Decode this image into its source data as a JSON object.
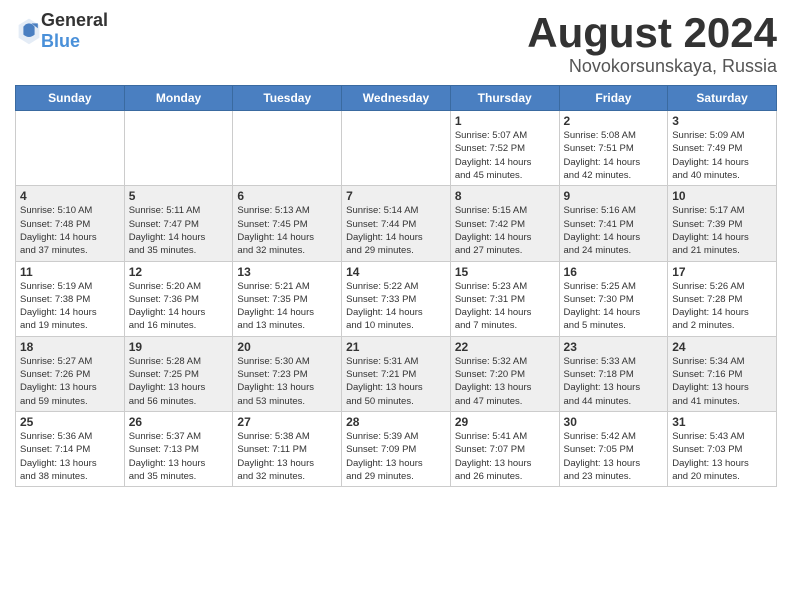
{
  "header": {
    "logo": {
      "general": "General",
      "blue": "Blue"
    },
    "title": "August 2024",
    "location": "Novokorsunskaya, Russia"
  },
  "weekdays": [
    "Sunday",
    "Monday",
    "Tuesday",
    "Wednesday",
    "Thursday",
    "Friday",
    "Saturday"
  ],
  "weeks": [
    [
      {
        "day": "",
        "info": ""
      },
      {
        "day": "",
        "info": ""
      },
      {
        "day": "",
        "info": ""
      },
      {
        "day": "",
        "info": ""
      },
      {
        "day": "1",
        "info": "Sunrise: 5:07 AM\nSunset: 7:52 PM\nDaylight: 14 hours\nand 45 minutes."
      },
      {
        "day": "2",
        "info": "Sunrise: 5:08 AM\nSunset: 7:51 PM\nDaylight: 14 hours\nand 42 minutes."
      },
      {
        "day": "3",
        "info": "Sunrise: 5:09 AM\nSunset: 7:49 PM\nDaylight: 14 hours\nand 40 minutes."
      }
    ],
    [
      {
        "day": "4",
        "info": "Sunrise: 5:10 AM\nSunset: 7:48 PM\nDaylight: 14 hours\nand 37 minutes."
      },
      {
        "day": "5",
        "info": "Sunrise: 5:11 AM\nSunset: 7:47 PM\nDaylight: 14 hours\nand 35 minutes."
      },
      {
        "day": "6",
        "info": "Sunrise: 5:13 AM\nSunset: 7:45 PM\nDaylight: 14 hours\nand 32 minutes."
      },
      {
        "day": "7",
        "info": "Sunrise: 5:14 AM\nSunset: 7:44 PM\nDaylight: 14 hours\nand 29 minutes."
      },
      {
        "day": "8",
        "info": "Sunrise: 5:15 AM\nSunset: 7:42 PM\nDaylight: 14 hours\nand 27 minutes."
      },
      {
        "day": "9",
        "info": "Sunrise: 5:16 AM\nSunset: 7:41 PM\nDaylight: 14 hours\nand 24 minutes."
      },
      {
        "day": "10",
        "info": "Sunrise: 5:17 AM\nSunset: 7:39 PM\nDaylight: 14 hours\nand 21 minutes."
      }
    ],
    [
      {
        "day": "11",
        "info": "Sunrise: 5:19 AM\nSunset: 7:38 PM\nDaylight: 14 hours\nand 19 minutes."
      },
      {
        "day": "12",
        "info": "Sunrise: 5:20 AM\nSunset: 7:36 PM\nDaylight: 14 hours\nand 16 minutes."
      },
      {
        "day": "13",
        "info": "Sunrise: 5:21 AM\nSunset: 7:35 PM\nDaylight: 14 hours\nand 13 minutes."
      },
      {
        "day": "14",
        "info": "Sunrise: 5:22 AM\nSunset: 7:33 PM\nDaylight: 14 hours\nand 10 minutes."
      },
      {
        "day": "15",
        "info": "Sunrise: 5:23 AM\nSunset: 7:31 PM\nDaylight: 14 hours\nand 7 minutes."
      },
      {
        "day": "16",
        "info": "Sunrise: 5:25 AM\nSunset: 7:30 PM\nDaylight: 14 hours\nand 5 minutes."
      },
      {
        "day": "17",
        "info": "Sunrise: 5:26 AM\nSunset: 7:28 PM\nDaylight: 14 hours\nand 2 minutes."
      }
    ],
    [
      {
        "day": "18",
        "info": "Sunrise: 5:27 AM\nSunset: 7:26 PM\nDaylight: 13 hours\nand 59 minutes."
      },
      {
        "day": "19",
        "info": "Sunrise: 5:28 AM\nSunset: 7:25 PM\nDaylight: 13 hours\nand 56 minutes."
      },
      {
        "day": "20",
        "info": "Sunrise: 5:30 AM\nSunset: 7:23 PM\nDaylight: 13 hours\nand 53 minutes."
      },
      {
        "day": "21",
        "info": "Sunrise: 5:31 AM\nSunset: 7:21 PM\nDaylight: 13 hours\nand 50 minutes."
      },
      {
        "day": "22",
        "info": "Sunrise: 5:32 AM\nSunset: 7:20 PM\nDaylight: 13 hours\nand 47 minutes."
      },
      {
        "day": "23",
        "info": "Sunrise: 5:33 AM\nSunset: 7:18 PM\nDaylight: 13 hours\nand 44 minutes."
      },
      {
        "day": "24",
        "info": "Sunrise: 5:34 AM\nSunset: 7:16 PM\nDaylight: 13 hours\nand 41 minutes."
      }
    ],
    [
      {
        "day": "25",
        "info": "Sunrise: 5:36 AM\nSunset: 7:14 PM\nDaylight: 13 hours\nand 38 minutes."
      },
      {
        "day": "26",
        "info": "Sunrise: 5:37 AM\nSunset: 7:13 PM\nDaylight: 13 hours\nand 35 minutes."
      },
      {
        "day": "27",
        "info": "Sunrise: 5:38 AM\nSunset: 7:11 PM\nDaylight: 13 hours\nand 32 minutes."
      },
      {
        "day": "28",
        "info": "Sunrise: 5:39 AM\nSunset: 7:09 PM\nDaylight: 13 hours\nand 29 minutes."
      },
      {
        "day": "29",
        "info": "Sunrise: 5:41 AM\nSunset: 7:07 PM\nDaylight: 13 hours\nand 26 minutes."
      },
      {
        "day": "30",
        "info": "Sunrise: 5:42 AM\nSunset: 7:05 PM\nDaylight: 13 hours\nand 23 minutes."
      },
      {
        "day": "31",
        "info": "Sunrise: 5:43 AM\nSunset: 7:03 PM\nDaylight: 13 hours\nand 20 minutes."
      }
    ]
  ]
}
